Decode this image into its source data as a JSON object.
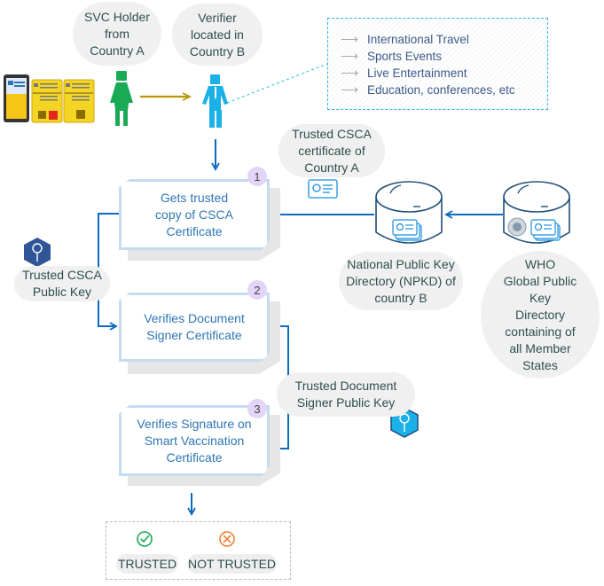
{
  "actors": {
    "holder_label": [
      "SVC Holder",
      "from",
      "Country A"
    ],
    "verifier_label": [
      "Verifier",
      "located in",
      "Country B"
    ]
  },
  "use_cases": {
    "items": [
      "International Travel",
      "Sports Events",
      "Live Entertainment",
      "Education, conferences, etc"
    ]
  },
  "csca_cert_label": [
    "Trusted CSCA",
    "certificate of",
    "Country A"
  ],
  "npkd_label": [
    "National Public Key",
    "Directory (NPKD) of",
    "country B"
  ],
  "who_label": [
    "WHO",
    "Global Public",
    "Key",
    "Directory",
    "containing of",
    "all Member",
    "States"
  ],
  "csca_key_label": [
    "Trusted CSCA",
    "Public Key"
  ],
  "ds_key_label": [
    "Trusted Document",
    "Signer Public Key"
  ],
  "steps": [
    {
      "number": "1",
      "lines": [
        "Gets trusted",
        "copy of CSCA",
        "Certificate"
      ]
    },
    {
      "number": "2",
      "lines": [
        "Verifies Document",
        "Signer Certificate"
      ]
    },
    {
      "number": "3",
      "lines": [
        "Verifies Signature on",
        "Smart Vaccination",
        "Certificate"
      ]
    }
  ],
  "results": {
    "trusted": "TRUSTED",
    "not_trusted": "NOT TRUSTED"
  },
  "colors": {
    "holder": "#1aaa55",
    "verifier": "#1ab0e8",
    "flow_arrow": "#0b6bbf",
    "transfer_arrow": "#b8960c",
    "step_text": "#2e75b6",
    "badge": "#e3d5f7",
    "trusted": "#1aaa55",
    "not_trusted": "#ee8033"
  }
}
